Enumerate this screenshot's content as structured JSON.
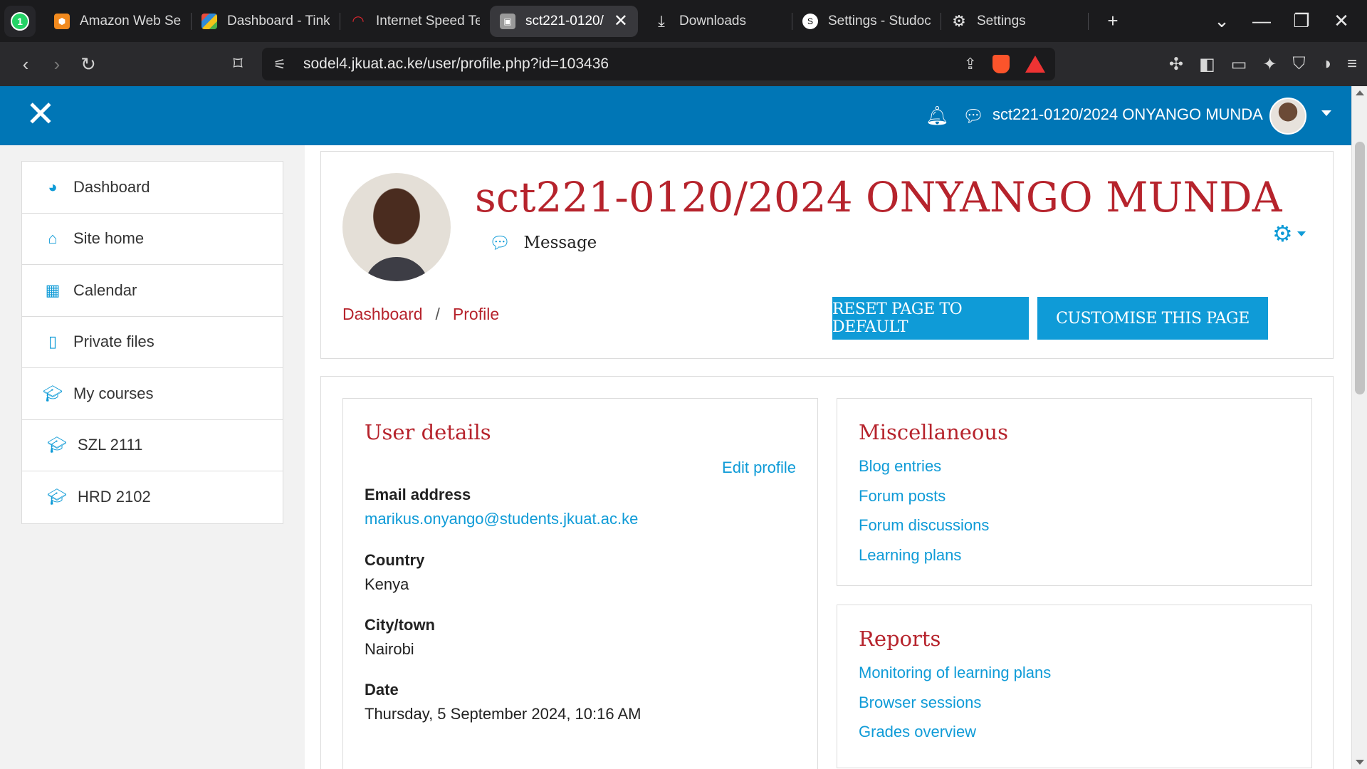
{
  "browser": {
    "tabs": [
      {
        "title": "Amazon Web Serv",
        "color": "#f28a1e",
        "icon": "aws-icon"
      },
      {
        "title": "Dashboard - Tink",
        "color": "#e84c3d",
        "icon": "tinkercad-icon"
      },
      {
        "title": "Internet Speed Te",
        "color": "#d9262e",
        "icon": "speedtest-icon"
      },
      {
        "title": "sct221-0120/",
        "color": "#888888",
        "icon": "moodle-page-icon",
        "active": true
      },
      {
        "title": "Downloads",
        "color": "#444444",
        "icon": "download-icon"
      },
      {
        "title": "Settings - Studoc",
        "color": "#ffffff",
        "icon": "studocu-icon"
      },
      {
        "title": "Settings",
        "color": "#444444",
        "icon": "settings-gear-icon"
      }
    ],
    "url": "sodel4.jkuat.ac.ke/user/profile.php?id=103436"
  },
  "header": {
    "user_name": "sct221-0120/2024 ONYANGO MUNDA"
  },
  "nav": {
    "items": [
      {
        "label": "Dashboard",
        "icon": "dashboard-icon",
        "glyph": "◕"
      },
      {
        "label": "Site home",
        "icon": "home-icon",
        "glyph": "⌂"
      },
      {
        "label": "Calendar",
        "icon": "calendar-icon",
        "glyph": "▦"
      },
      {
        "label": "Private files",
        "icon": "file-icon",
        "glyph": "▯"
      },
      {
        "label": "My courses",
        "icon": "graduation-cap-icon",
        "glyph": "🎓"
      },
      {
        "label": "SZL 2111",
        "icon": "graduation-cap-icon",
        "glyph": "🎓",
        "sub": true
      },
      {
        "label": "HRD 2102",
        "icon": "graduation-cap-icon",
        "glyph": "🎓",
        "sub": true
      }
    ]
  },
  "profile": {
    "name": "sct221-0120/2024 ONYANGO MUNDA",
    "message_label": "Message",
    "breadcrumb": [
      "Dashboard",
      "Profile"
    ],
    "reset_button": "RESET PAGE TO DEFAULT",
    "customise_button": "CUSTOMISE THIS PAGE"
  },
  "user_details": {
    "title": "User details",
    "edit_link": "Edit profile",
    "fields": [
      {
        "label": "Email address",
        "value": "marikus.onyango@students.jkuat.ac.ke",
        "link": true
      },
      {
        "label": "Country",
        "value": "Kenya"
      },
      {
        "label": "City/town",
        "value": "Nairobi"
      },
      {
        "label": "Date",
        "value": "Thursday, 5 September 2024, 10:16 AM"
      }
    ]
  },
  "miscellaneous": {
    "title": "Miscellaneous",
    "links": [
      "Blog entries",
      "Forum posts",
      "Forum discussions",
      "Learning plans"
    ]
  },
  "reports": {
    "title": "Reports",
    "links": [
      "Monitoring of learning plans",
      "Browser sessions",
      "Grades overview"
    ]
  },
  "colors": {
    "brand": "#0076b6",
    "accent": "#0f9bd7",
    "title_red": "#b6232c"
  }
}
